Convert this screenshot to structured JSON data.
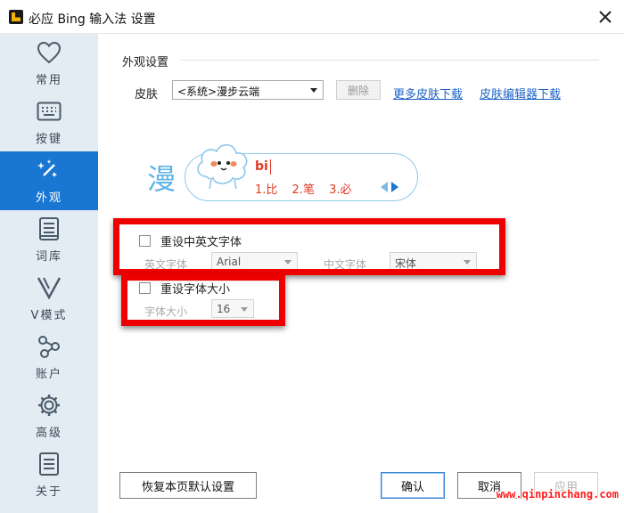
{
  "window": {
    "title": "必应 Bing 输入法 设置",
    "app_icon": "bing-ime-icon",
    "close_icon": "close-icon"
  },
  "sidebar": {
    "active_index": 2,
    "items": [
      {
        "label": "常用",
        "icon": "heart-icon"
      },
      {
        "label": "按键",
        "icon": "keyboard-icon"
      },
      {
        "label": "外观",
        "icon": "magic-wand-icon"
      },
      {
        "label": "词库",
        "icon": "book-icon"
      },
      {
        "label": "V模式",
        "icon": "v-mode-icon"
      },
      {
        "label": "账户",
        "icon": "share-nodes-icon"
      },
      {
        "label": "高级",
        "icon": "gear-icon"
      },
      {
        "label": "关于",
        "icon": "document-icon"
      }
    ]
  },
  "appearance": {
    "section_title": "外观设置",
    "skin_label": "皮肤",
    "skin_value": "<系统>漫步云端",
    "delete_label": "删除",
    "more_skins_link": "更多皮肤下载",
    "skin_editor_link": "皮肤编辑器下载"
  },
  "preview": {
    "mode_char": "漫",
    "input_text": "bi",
    "candidates": [
      "1.比",
      "2.笔",
      "3.必"
    ]
  },
  "font_reset": {
    "checkbox_label": "重设中英文字体",
    "checked": false,
    "english_font_label": "英文字体",
    "english_font_value": "Arial",
    "chinese_font_label": "中文字体",
    "chinese_font_value": "宋体"
  },
  "size_reset": {
    "checkbox_label": "重设字体大小",
    "checked": false,
    "size_label": "字体大小",
    "size_value": "16"
  },
  "footer": {
    "restore_label": "恢复本页默认设置",
    "ok_label": "确认",
    "cancel_label": "取消",
    "apply_label": "应用"
  },
  "watermark": "www.qinpinchang.com",
  "colors": {
    "accent": "#1976d2",
    "sidebar_bg": "#e4ecf3",
    "highlight_red": "#ee0000",
    "link": "#1f63c6"
  }
}
